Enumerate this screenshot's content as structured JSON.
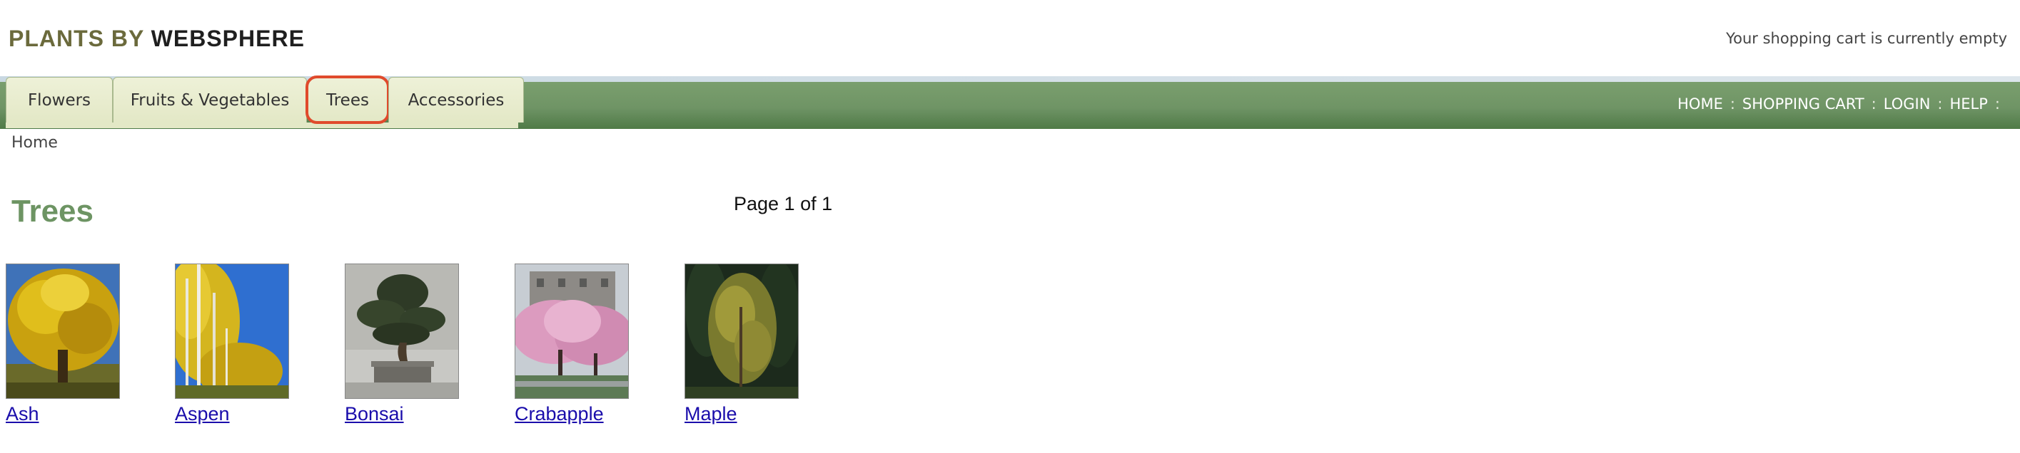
{
  "header": {
    "logo_part1": "PLANTS BY ",
    "logo_part2": "WEBSPHERE",
    "cart_status": "Your shopping cart is currently empty"
  },
  "nav": {
    "tabs": [
      {
        "label": "Flowers"
      },
      {
        "label": "Fruits & Vegetables"
      },
      {
        "label": "Trees"
      },
      {
        "label": "Accessories"
      }
    ],
    "links": [
      {
        "label": "HOME"
      },
      {
        "label": "SHOPPING CART"
      },
      {
        "label": "LOGIN"
      },
      {
        "label": "HELP"
      }
    ],
    "separator": ":"
  },
  "breadcrumb": "Home",
  "main": {
    "title": "Trees",
    "page_info": "Page 1 of 1",
    "products": [
      {
        "name": "Ash",
        "icon": "ash-tree-photo"
      },
      {
        "name": "Aspen",
        "icon": "aspen-tree-photo"
      },
      {
        "name": "Bonsai",
        "icon": "bonsai-tree-photo"
      },
      {
        "name": "Crabapple",
        "icon": "crabapple-tree-photo"
      },
      {
        "name": "Maple",
        "icon": "maple-tree-photo"
      }
    ]
  },
  "colors": {
    "nav_green": "#6f9465",
    "tab_fill": "#e3e8c6",
    "title_green": "#6d9463",
    "link_blue": "#1a0dab",
    "highlight_red": "#e04a2c"
  }
}
